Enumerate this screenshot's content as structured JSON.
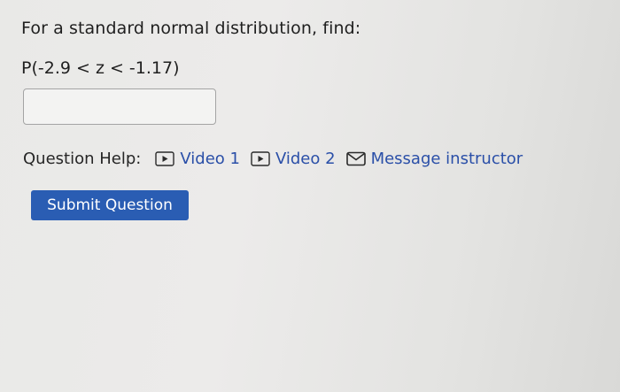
{
  "question": {
    "prompt": "For a standard normal distribution, find:",
    "expression": "P(-2.9 < z < -1.17)"
  },
  "answer_input": {
    "value": ""
  },
  "help": {
    "label": "Question Help:",
    "links": [
      {
        "label": "Video 1",
        "icon": "video-play-icon"
      },
      {
        "label": "Video 2",
        "icon": "video-play-icon"
      },
      {
        "label": "Message instructor",
        "icon": "envelope-icon"
      }
    ]
  },
  "submit": {
    "label": "Submit Question"
  },
  "colors": {
    "link": "#2a4fa8",
    "button": "#2a5db3",
    "button_text": "#ffffff"
  }
}
